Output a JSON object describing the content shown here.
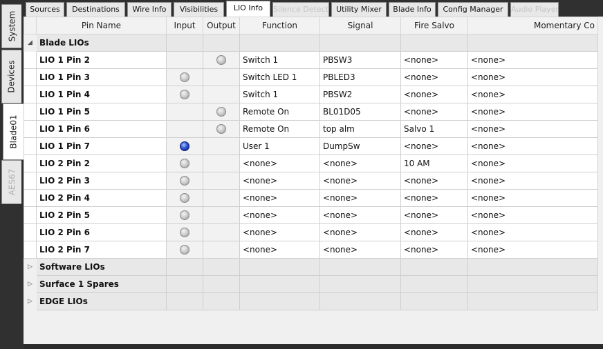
{
  "side_tabs": [
    {
      "label": "System",
      "state": "normal"
    },
    {
      "label": "Devices",
      "state": "normal"
    },
    {
      "label": "Blade01",
      "state": "active"
    },
    {
      "label": "AES67",
      "state": "disabled"
    }
  ],
  "top_tabs": [
    {
      "label": "Sources",
      "state": "normal"
    },
    {
      "label": "Destinations",
      "state": "normal"
    },
    {
      "label": "Wire Info",
      "state": "normal"
    },
    {
      "label": "Visibilities",
      "state": "normal"
    },
    {
      "label": "LIO Info",
      "state": "active"
    },
    {
      "label": "Silence Detect",
      "state": "disabled"
    },
    {
      "label": "Utility Mixer",
      "state": "normal"
    },
    {
      "label": "Blade Info",
      "state": "normal"
    },
    {
      "label": "Config Manager",
      "state": "normal"
    },
    {
      "label": "Audio Player",
      "state": "disabled"
    }
  ],
  "columns": {
    "pin_name": "Pin Name",
    "input": "Input",
    "output": "Output",
    "function": "Function",
    "signal": "Signal",
    "fire_salvo": "Fire Salvo",
    "momentary": "Momentary Co"
  },
  "groups": {
    "blade": {
      "label": "Blade LIOs",
      "expander": "◢"
    },
    "software": {
      "label": "Software LIOs",
      "expander": "▷"
    },
    "surface": {
      "label": "Surface 1 Spares",
      "expander": "▷"
    },
    "edge": {
      "label": "EDGE LIOs",
      "expander": "▷"
    }
  },
  "rows": [
    {
      "pin": "LIO 1 Pin 2",
      "input": "",
      "output": "off",
      "function": "Switch 1",
      "signal": "PBSW3",
      "fire_salvo": "<none>",
      "momentary": "<none>"
    },
    {
      "pin": "LIO 1 Pin 3",
      "input": "off",
      "output": "",
      "function": "Switch LED 1",
      "signal": "PBLED3",
      "fire_salvo": "<none>",
      "momentary": "<none>"
    },
    {
      "pin": "LIO 1 Pin 4",
      "input": "off",
      "output": "",
      "function": "Switch 1",
      "signal": "PBSW2",
      "fire_salvo": "<none>",
      "momentary": "<none>"
    },
    {
      "pin": "LIO 1 Pin 5",
      "input": "",
      "output": "off",
      "function": "Remote On",
      "signal": "BL01D05",
      "fire_salvo": "<none>",
      "momentary": "<none>"
    },
    {
      "pin": "LIO 1 Pin 6",
      "input": "",
      "output": "off",
      "function": "Remote On",
      "signal": "top alm",
      "fire_salvo": "Salvo 1",
      "momentary": "<none>"
    },
    {
      "pin": "LIO 1 Pin 7",
      "input": "on",
      "output": "",
      "function": "User 1",
      "signal": "DumpSw",
      "fire_salvo": "<none>",
      "momentary": "<none>"
    },
    {
      "pin": "LIO 2 Pin 2",
      "input": "off",
      "output": "",
      "function": "<none>",
      "signal": "<none>",
      "fire_salvo": "10 AM",
      "momentary": "<none>"
    },
    {
      "pin": "LIO 2 Pin 3",
      "input": "off",
      "output": "",
      "function": "<none>",
      "signal": "<none>",
      "fire_salvo": "<none>",
      "momentary": "<none>"
    },
    {
      "pin": "LIO 2 Pin 4",
      "input": "off",
      "output": "",
      "function": "<none>",
      "signal": "<none>",
      "fire_salvo": "<none>",
      "momentary": "<none>"
    },
    {
      "pin": "LIO 2 Pin 5",
      "input": "off",
      "output": "",
      "function": "<none>",
      "signal": "<none>",
      "fire_salvo": "<none>",
      "momentary": "<none>"
    },
    {
      "pin": "LIO 2 Pin 6",
      "input": "off",
      "output": "",
      "function": "<none>",
      "signal": "<none>",
      "fire_salvo": "<none>",
      "momentary": "<none>"
    },
    {
      "pin": "LIO 2 Pin 7",
      "input": "off",
      "output": "",
      "function": "<none>",
      "signal": "<none>",
      "fire_salvo": "<none>",
      "momentary": "<none>"
    }
  ],
  "colors": {
    "active_led": "#2e55d6",
    "idle_led": "#cfcfcf",
    "background_dark": "#2b2b2b"
  }
}
